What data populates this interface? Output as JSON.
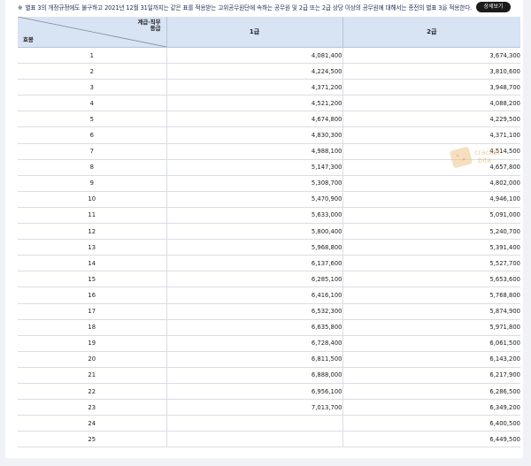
{
  "notice": {
    "mark": "※",
    "text": "별표 3의 개정규정에도 불구하고 2021년 12월 31일까지는 같은 표를 적용받는 고위공무원단에 속하는 공무원 및 2급 또는 2급 상당 이상의 공무원에 대해서는 종전의 별표 3을 적용한다.",
    "detail_button": "상세보기"
  },
  "table": {
    "corner_top_line1": "계급·직무",
    "corner_top_line2": "등급",
    "corner_bottom": "호봉",
    "col1": "1급",
    "col2": "2급",
    "rows": [
      {
        "step": "1",
        "g1": "4,081,400",
        "g2": "3,674,300"
      },
      {
        "step": "2",
        "g1": "4,224,500",
        "g2": "3,810,600"
      },
      {
        "step": "3",
        "g1": "4,371,200",
        "g2": "3,948,700"
      },
      {
        "step": "4",
        "g1": "4,521,200",
        "g2": "4,088,200"
      },
      {
        "step": "5",
        "g1": "4,674,800",
        "g2": "4,229,500"
      },
      {
        "step": "6",
        "g1": "4,830,300",
        "g2": "4,371,100"
      },
      {
        "step": "7",
        "g1": "4,988,100",
        "g2": "4,514,500"
      },
      {
        "step": "8",
        "g1": "5,147,300",
        "g2": "4,657,800"
      },
      {
        "step": "9",
        "g1": "5,308,700",
        "g2": "4,802,000"
      },
      {
        "step": "10",
        "g1": "5,470,900",
        "g2": "4,946,100"
      },
      {
        "step": "11",
        "g1": "5,633,000",
        "g2": "5,091,000"
      },
      {
        "step": "12",
        "g1": "5,800,400",
        "g2": "5,240,700"
      },
      {
        "step": "13",
        "g1": "5,968,800",
        "g2": "5,391,400"
      },
      {
        "step": "14",
        "g1": "6,137,600",
        "g2": "5,527,700"
      },
      {
        "step": "15",
        "g1": "6,285,100",
        "g2": "5,653,600"
      },
      {
        "step": "16",
        "g1": "6,416,100",
        "g2": "5,768,800"
      },
      {
        "step": "17",
        "g1": "6,532,300",
        "g2": "5,874,900"
      },
      {
        "step": "18",
        "g1": "6,635,800",
        "g2": "5,971,800"
      },
      {
        "step": "19",
        "g1": "6,728,400",
        "g2": "6,061,500"
      },
      {
        "step": "20",
        "g1": "6,811,500",
        "g2": "6,143,200"
      },
      {
        "step": "21",
        "g1": "6,888,000",
        "g2": "6,217,900"
      },
      {
        "step": "22",
        "g1": "6,956,100",
        "g2": "6,286,500"
      },
      {
        "step": "23",
        "g1": "7,013,700",
        "g2": "6,349,200"
      },
      {
        "step": "24",
        "g1": "",
        "g2": "6,400,500"
      },
      {
        "step": "25",
        "g1": "",
        "g2": "6,449,500"
      }
    ]
  },
  "watermark": {
    "line1": "cracker",
    "line2": "bite"
  }
}
